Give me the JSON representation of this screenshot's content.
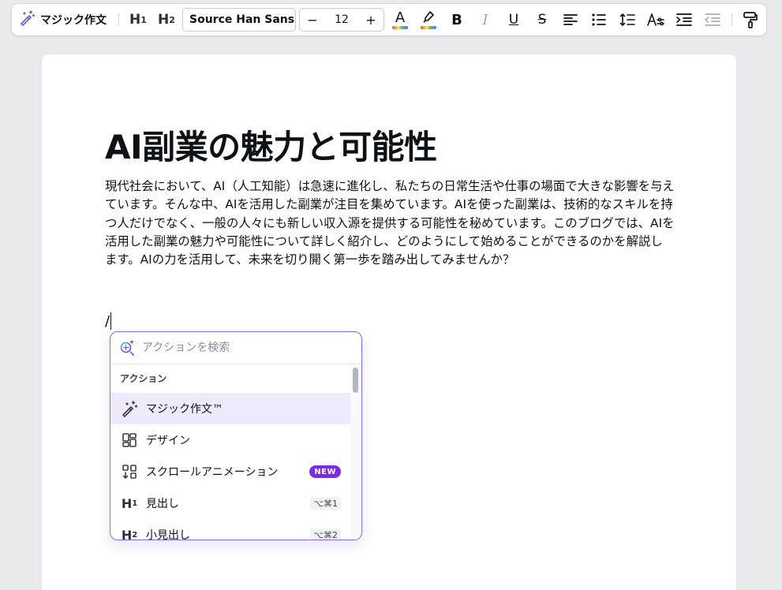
{
  "toolbar": {
    "magic_write_label": "マジック作文",
    "h1_label": "H",
    "h1_sub": "1",
    "h2_label": "H",
    "h2_sub": "2",
    "font_family": "Source Han Sans ...",
    "font_size": "12",
    "decrease_label": "−",
    "increase_label": "+",
    "text_color_glyph": "A",
    "bold_glyph": "B",
    "italic_glyph": "I",
    "underline_glyph": "U",
    "strike_glyph": "S",
    "icons": [
      "magic-wand-icon",
      "text-color-icon",
      "highlight-icon",
      "align-left-icon",
      "bullet-list-icon",
      "line-spacing-icon",
      "text-effects-icon",
      "indent-icon",
      "outdent-icon",
      "paint-roller-icon"
    ]
  },
  "document": {
    "title": "AI副業の魅力と可能性",
    "body": "現代社会において、AI（人工知能）は急速に進化し、私たちの日常生活や仕事の場面で大きな影響を与えています。そんな中、AIを活用した副業が注目を集めています。AIを使った副業は、技術的なスキルを持つ人だけでなく、一般の人々にも新しい収入源を提供する可能性を秘めています。このブログでは、AIを活用した副業の魅力や可能性について詳しく紹介し、どのようにして始めることができるのかを解説します。AIの力を活用して、未来を切り開く第一歩を踏み出してみませんか？",
    "slash_text": "/"
  },
  "popup": {
    "search_placeholder": "アクションを検索",
    "section_label": "アクション",
    "items": [
      {
        "label": "マジック作文™",
        "icon": "magic-wand-icon",
        "active": true
      },
      {
        "label": "デザイン",
        "icon": "design-grid-icon"
      },
      {
        "label": "スクロールアニメーション",
        "icon": "scroll-animation-icon",
        "badge": "NEW"
      },
      {
        "label": "見出し",
        "icon": "heading1-icon",
        "shortcut": "⌥⌘1"
      },
      {
        "label": "小見出し",
        "icon": "heading2-icon",
        "shortcut": "⌥⌘2"
      }
    ]
  },
  "colors": {
    "accent_purple": "#7d2ae8",
    "popup_border": "#8c6af0",
    "active_row": "#eeeafc",
    "background": "#e9eaee"
  }
}
